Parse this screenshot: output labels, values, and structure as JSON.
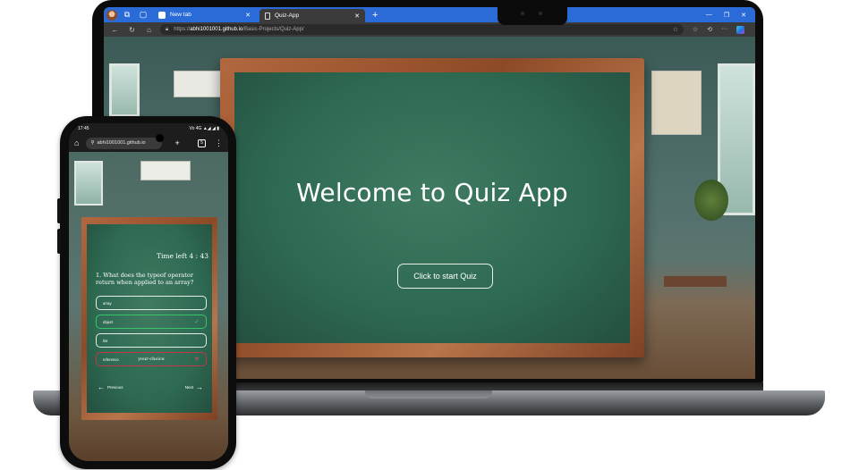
{
  "laptop": {
    "tabs": [
      {
        "title": "New tab",
        "active": false
      },
      {
        "title": "Quiz-App",
        "active": true
      }
    ],
    "address": {
      "scheme": "https://",
      "host": "abhi1001001.github.io",
      "path": "/Basic-Projects/Quiz-App/"
    },
    "page": {
      "heading": "Welcome to Quiz App",
      "start_button": "Click to start Quiz"
    }
  },
  "phone": {
    "status_time": "17:45",
    "status_icons": "Vo 4G ▲◢ ◢ ▮",
    "url": "abhi1001001.github.io",
    "tab_count": "5",
    "quiz": {
      "timer": "Time left 4 : 43",
      "question": "1. What does the typeof operator return when applied to an array?",
      "options": [
        {
          "label": "array",
          "state": "neutral"
        },
        {
          "label": "object",
          "state": "correct"
        },
        {
          "label": "list",
          "state": "neutral"
        },
        {
          "label": "reference",
          "state": "wrong",
          "note": "your-choice"
        }
      ],
      "prev_label": "Previous",
      "next_label": "Next"
    }
  },
  "colors": {
    "browser_tabbar": "#2a6bd8",
    "chalkboard": "#2e6a52",
    "frame_wood": "#a5603a",
    "correct": "#38c46b",
    "wrong": "#c4364a"
  }
}
